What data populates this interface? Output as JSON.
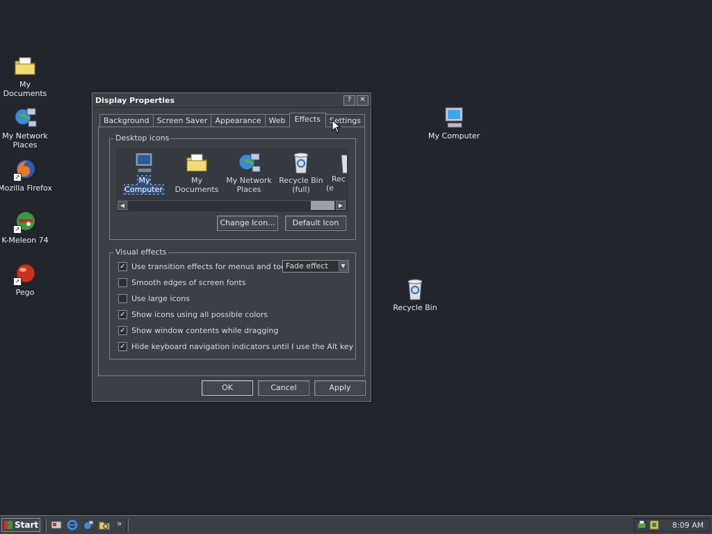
{
  "desktop": {
    "icons": [
      {
        "label": "My Documents"
      },
      {
        "label": "My Network Places"
      },
      {
        "label": "Mozilla Firefox"
      },
      {
        "label": "K-Meleon 74"
      },
      {
        "label": "Pego"
      },
      {
        "label": "My Computer"
      },
      {
        "label": "Recycle Bin"
      }
    ]
  },
  "window": {
    "title": "Display Properties",
    "help_label": "?",
    "close_label": "✕",
    "tabs": [
      {
        "label": "Background"
      },
      {
        "label": "Screen Saver"
      },
      {
        "label": "Appearance"
      },
      {
        "label": "Web"
      },
      {
        "label": "Effects"
      },
      {
        "label": "Settings"
      }
    ],
    "active_tab": "Effects",
    "desktop_icons": {
      "group_label": "Desktop icons",
      "items": [
        {
          "label": "My Computer"
        },
        {
          "label": "My Documents"
        },
        {
          "label": "My Network Places"
        },
        {
          "label": "Recycle Bin (full)"
        },
        {
          "label": "Rec (e"
        }
      ],
      "selected": "My Computer",
      "change_icon_label": "Change Icon...",
      "default_icon_label": "Default Icon"
    },
    "visual_effects": {
      "group_label": "Visual effects",
      "options": [
        {
          "label": "Use transition effects for menus and tooltips",
          "checked": true
        },
        {
          "label": "Smooth edges of screen fonts",
          "checked": false
        },
        {
          "label": "Use large icons",
          "checked": false
        },
        {
          "label": "Show icons using all possible colors",
          "checked": true
        },
        {
          "label": "Show window contents while dragging",
          "checked": true
        },
        {
          "label": "Hide keyboard navigation indicators until I use the Alt key",
          "checked": true
        }
      ],
      "transition_select_value": "Fade effect"
    },
    "buttons": {
      "ok": "OK",
      "cancel": "Cancel",
      "apply": "Apply"
    }
  },
  "taskbar": {
    "start_label": "Start",
    "chevron": "»",
    "clock": "8:09 AM"
  },
  "glyphs": {
    "check": "✓",
    "arrow_left": "◀",
    "arrow_right": "▶",
    "arrow_down": "▼",
    "shortcut": "↗"
  }
}
